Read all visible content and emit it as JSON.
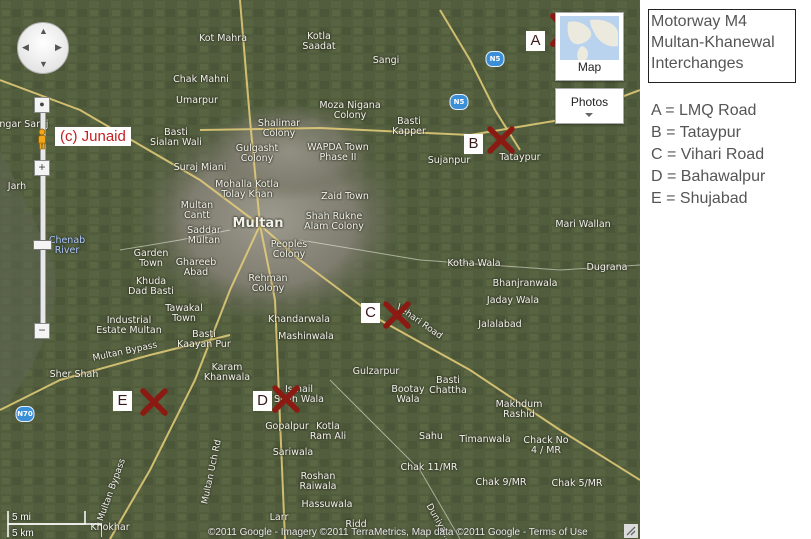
{
  "title_lines": [
    "Motorway M4",
    "Multan-Khanewal",
    "Interchanges"
  ],
  "legend": [
    "A = LMQ Road",
    "B = Tataypur",
    "C = Vihari Road",
    "D = Bahawalpur",
    "E = Shujabad"
  ],
  "markers": [
    {
      "letter": "A",
      "name": "LMQ Road"
    },
    {
      "letter": "B",
      "name": "Tataypur"
    },
    {
      "letter": "C",
      "name": "Vihari Road"
    },
    {
      "letter": "D",
      "name": "Bahawalpur"
    },
    {
      "letter": "E",
      "name": "Shujabad"
    }
  ],
  "credit": "(c) Junaid",
  "map_type_button": "Map",
  "photos_button": "Photos",
  "scale": {
    "miles": "5 mi",
    "km": "5 km"
  },
  "copyright": "©2011 Google - Imagery ©2011 TerraMetrics, Map data ©2011 Google - Terms of Use",
  "highway_shields": [
    "N5",
    "N5",
    "N70"
  ],
  "places": [
    "Kot Mahra",
    "Kotla\nSaadat",
    "Sangi",
    "Chak Mahni",
    "Umarpur",
    "Moza Nigana\nColony",
    "Basti\nSialan Wali",
    "Shalimar\nColony",
    "WAPDA Town\nPhase II",
    "Basti\nKapper",
    "Tataypur",
    "Sujanpur",
    "Gulgasht\nColony",
    "Suraj Miani",
    "Mohalla Kotla\nTolay Khan",
    "Zaid Town",
    "Multan\nCantt",
    "Saddar\nMultan",
    "Multan",
    "Shah Rukne\nAlam Colony",
    "Peoples\nColony",
    "Mari Wallan",
    "Garden\nTown",
    "Ghareeb\nAbad",
    "Kotha Wala",
    "Dugrana",
    "Khuda\nDad Basti",
    "Rehman\nColony",
    "Bhanjranwala",
    "Jaday Wala",
    "Tawakal\nTown",
    "Industrial\nEstate Multan",
    "Khandarwala",
    "Jalalabad",
    "Mashinwala",
    "Basti\nKaayan Pur",
    "Karam\nKhanwala",
    "Sher Shah",
    "Gulzarpur",
    "Bootay\nWala",
    "Basti\nChattha",
    "Ismail\nShah Wala",
    "Makhdum\nRashid",
    "Gopalpur",
    "Kotla\nRam Ali",
    "Sahu",
    "Timanwala",
    "Chack No\n4 / MR",
    "Sariwala",
    "Chak 11/MR",
    "Chak 9/MR",
    "Chak 5/MR",
    "Roshan\nRaiwala",
    "Hassuwala",
    "Ridd",
    "Larr",
    "Khokhar",
    "Jarh",
    "Sangar Saraj"
  ],
  "water_labels": [
    "Chenab\nRiver"
  ],
  "road_labels": [
    "Multan Bypass",
    "Vehari Road",
    "Multan Bypass",
    "Multan Uch Rd",
    "Duniya..."
  ]
}
